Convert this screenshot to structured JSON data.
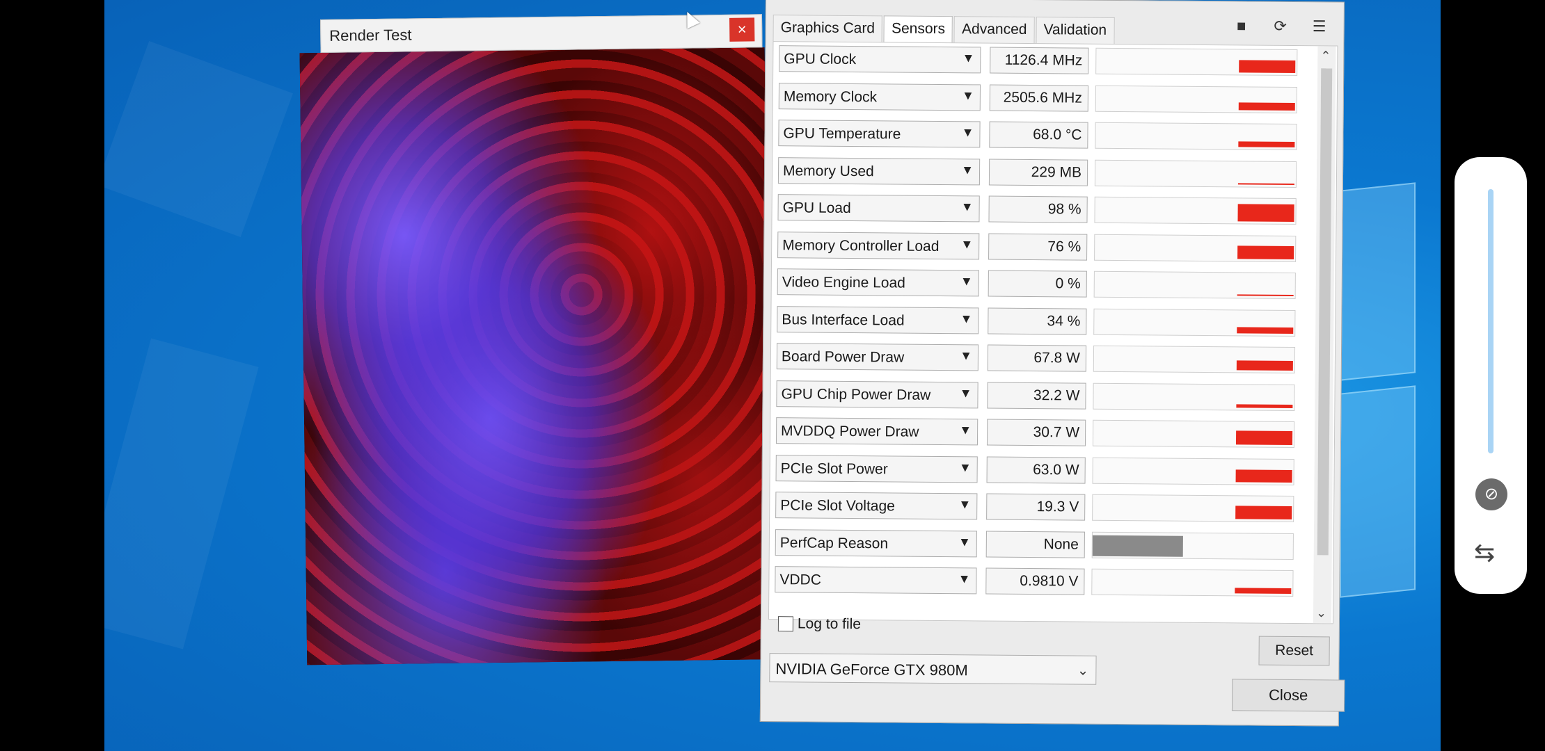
{
  "render_window": {
    "title": "Render Test",
    "close_glyph": "×"
  },
  "gpuz": {
    "tabs": [
      {
        "label": "Graphics Card"
      },
      {
        "label": "Sensors"
      },
      {
        "label": "Advanced"
      },
      {
        "label": "Validation"
      }
    ],
    "active_tab": "Sensors",
    "toolbar_icons": [
      "camera-icon",
      "refresh-icon",
      "menu-icon"
    ],
    "sensors": [
      {
        "name": "GPU Clock",
        "value": "1126.4 MHz",
        "level": 0.72
      },
      {
        "name": "Memory Clock",
        "value": "2505.6 MHz",
        "level": 0.45
      },
      {
        "name": "GPU Temperature",
        "value": "68.0 °C",
        "level": 0.3
      },
      {
        "name": "Memory Used",
        "value": "229 MB",
        "level": 0.03
      },
      {
        "name": "GPU Load",
        "value": "98 %",
        "level": 0.98
      },
      {
        "name": "Memory Controller Load",
        "value": "76 %",
        "level": 0.76
      },
      {
        "name": "Video Engine Load",
        "value": "0 %",
        "level": 0.0
      },
      {
        "name": "Bus Interface Load",
        "value": "34 %",
        "level": 0.34
      },
      {
        "name": "Board Power Draw",
        "value": "67.8 W",
        "level": 0.55
      },
      {
        "name": "GPU Chip Power Draw",
        "value": "32.2 W",
        "level": 0.2
      },
      {
        "name": "MVDDQ Power Draw",
        "value": "30.7 W",
        "level": 0.8
      },
      {
        "name": "PCIe Slot Power",
        "value": "63.0 W",
        "level": 0.7
      },
      {
        "name": "PCIe Slot Voltage",
        "value": "19.3 V",
        "level": 0.75
      },
      {
        "name": "PerfCap Reason",
        "value": "None",
        "level": 1.0
      },
      {
        "name": "VDDC",
        "value": "0.9810 V",
        "level": 0.3
      }
    ],
    "log_to_file_label": "Log to file",
    "reset_label": "Reset",
    "gpu_model": "NVIDIA GeForce GTX 980M",
    "close_label": "Close"
  },
  "colors": {
    "graph_red": "#e8271b",
    "perfcap_grey": "#8a8a8a",
    "desktop_blue": "#0b78d0"
  },
  "side_panel": {
    "icons": [
      "brightness-slider",
      "hide-icon",
      "swap-icon"
    ]
  }
}
